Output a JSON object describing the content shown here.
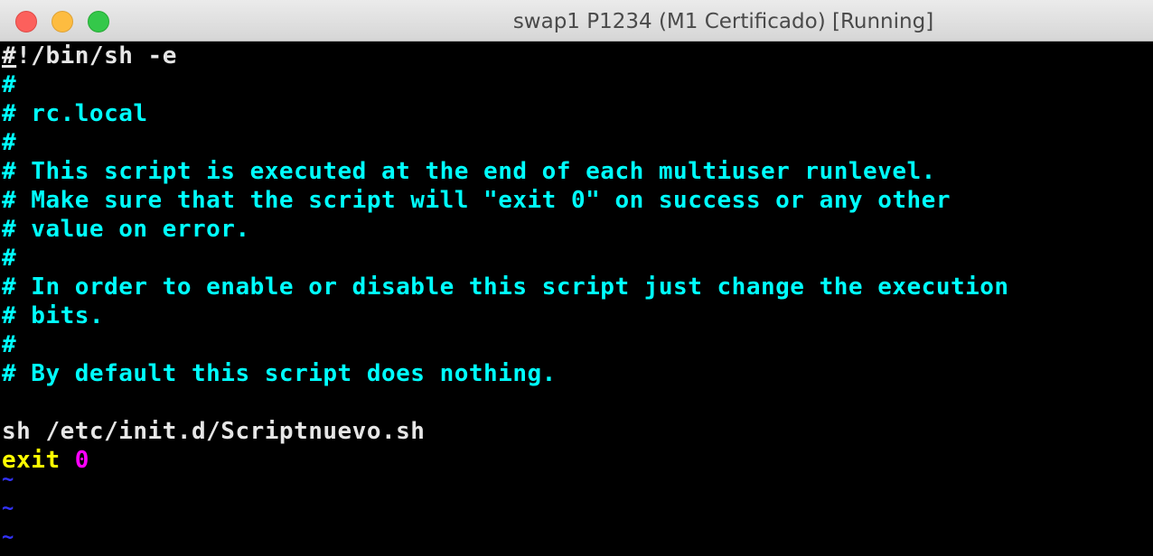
{
  "window": {
    "title": "swap1 P1234 (M1 Certificado) [Running]"
  },
  "colors": {
    "comment": "#00ffff",
    "normal": "#e6e6e6",
    "keyword": "#ffff00",
    "number": "#ff00ff",
    "tilde": "#3333ff",
    "background": "#000000"
  },
  "editor": {
    "shebang_cursor_char": "#",
    "shebang_rest": "!/bin/sh -e",
    "comment_lines": [
      "#",
      "# rc.local",
      "#",
      "# This script is executed at the end of each multiuser runlevel.",
      "# Make sure that the script will \"exit 0\" on success or any other",
      "# value on error.",
      "#",
      "# In order to enable or disable this script just change the execution",
      "# bits.",
      "#",
      "# By default this script does nothing."
    ],
    "command_line": "sh /etc/init.d/Scriptnuevo.sh",
    "exit_keyword": "exit",
    "exit_code": "0",
    "empty_line_marker": "~"
  }
}
